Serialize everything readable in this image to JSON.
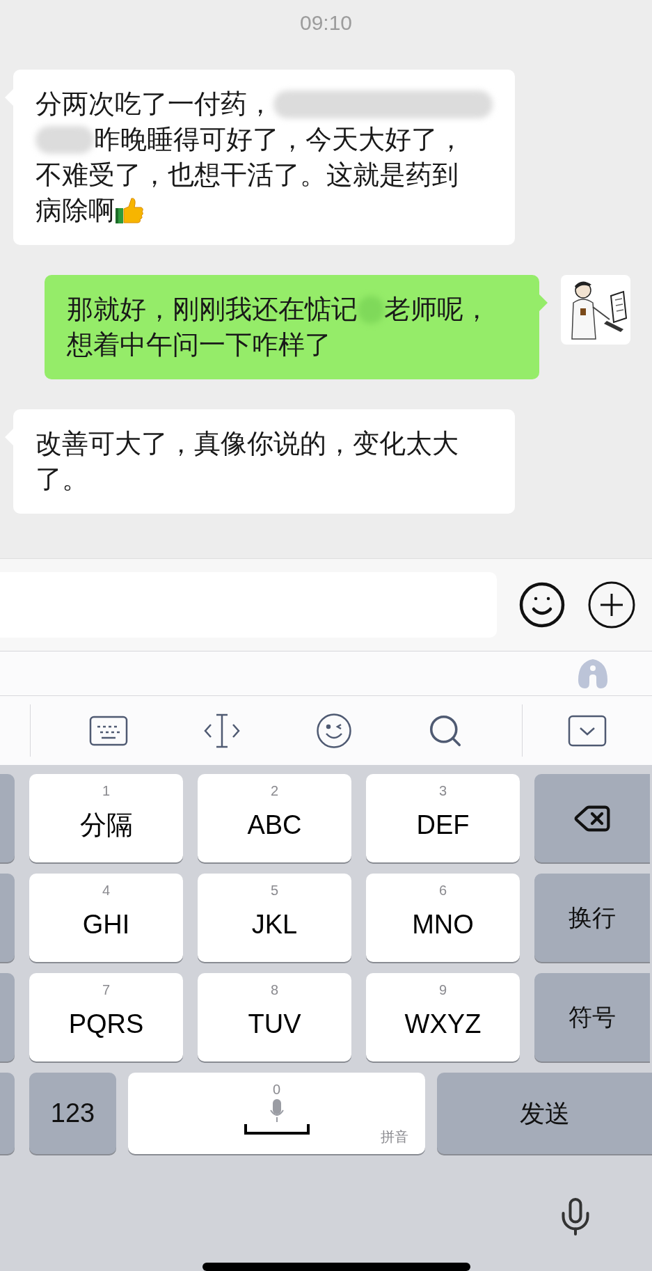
{
  "status_time": "09:10",
  "messages": [
    {
      "sent": false,
      "lines": [
        [
          {
            "kind": "text",
            "text": "分两次吃了一付药，"
          },
          {
            "kind": "blur"
          }
        ],
        [
          {
            "kind": "blur"
          },
          {
            "kind": "text",
            "text": "昨晚睡得可好了，今天大好了，"
          }
        ],
        [
          {
            "kind": "text",
            "text": "不难受了，也想干活了。这就是药到"
          }
        ],
        [
          {
            "kind": "text",
            "text": "病除啊"
          },
          {
            "kind": "emoji"
          }
        ]
      ]
    },
    {
      "sent": true,
      "lines": [
        [
          {
            "kind": "text",
            "text": "那就好，刚刚我还在惦记"
          },
          {
            "kind": "blur"
          },
          {
            "kind": "text",
            "text": "老师呢，"
          }
        ],
        [
          {
            "kind": "text",
            "text": "想着中午问一下咋样了"
          }
        ]
      ]
    },
    {
      "sent": false,
      "lines": [
        [
          {
            "kind": "text",
            "text": "改善可大了，真像你说的，变化太大"
          }
        ],
        [
          {
            "kind": "text",
            "text": "了。"
          }
        ]
      ]
    }
  ],
  "keyboard": {
    "rows": [
      [
        {
          "kind": "letter",
          "number": "1",
          "label": "分隔"
        },
        {
          "kind": "letter",
          "number": "2",
          "label": "ABC"
        },
        {
          "kind": "letter",
          "number": "3",
          "label": "DEF"
        },
        {
          "kind": "delete"
        }
      ],
      [
        {
          "kind": "letter",
          "number": "4",
          "label": "GHI"
        },
        {
          "kind": "letter",
          "number": "5",
          "label": "JKL"
        },
        {
          "kind": "letter",
          "number": "6",
          "label": "MNO"
        },
        {
          "kind": "function",
          "label": "换行"
        }
      ],
      [
        {
          "kind": "letter",
          "number": "7",
          "label": "PQRS"
        },
        {
          "kind": "letter",
          "number": "8",
          "label": "TUV"
        },
        {
          "kind": "letter",
          "number": "9",
          "label": "WXYZ"
        },
        {
          "kind": "function",
          "label": "符号"
        }
      ],
      [
        {
          "kind": "function",
          "label": "123"
        },
        {
          "kind": "space",
          "number": "0",
          "label": "拼音"
        },
        {
          "kind": "function",
          "label": "发送"
        }
      ]
    ]
  }
}
